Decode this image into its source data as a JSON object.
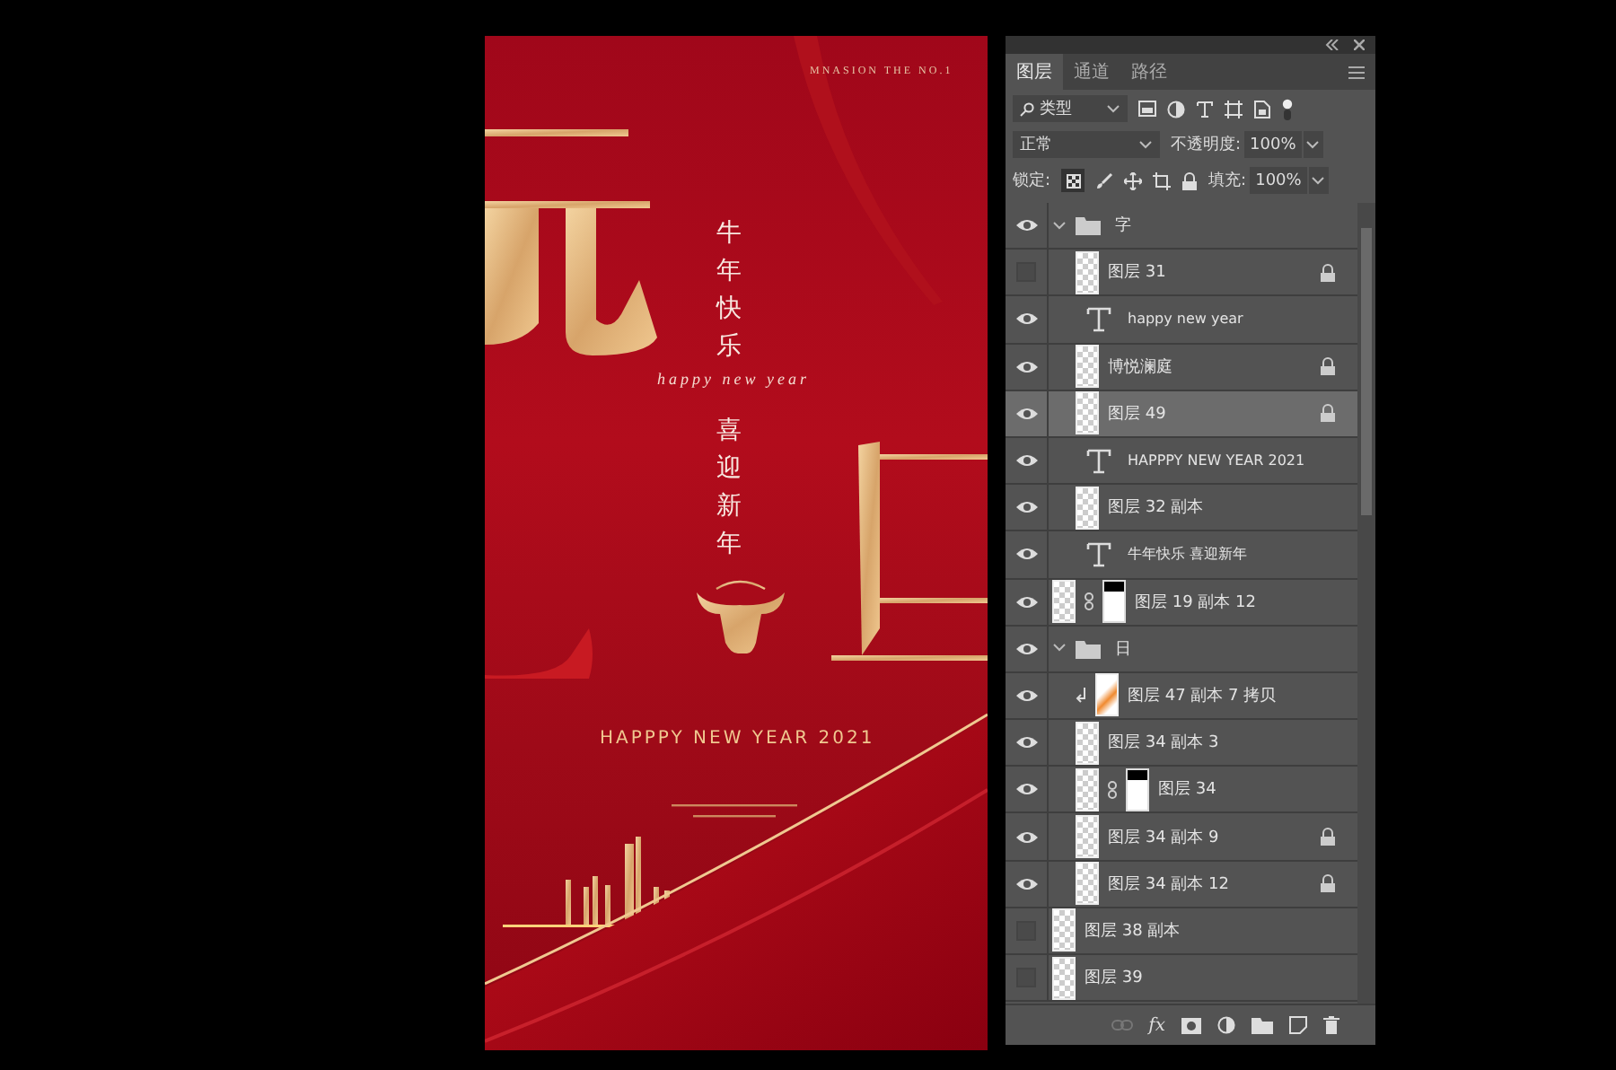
{
  "poster": {
    "tagline": "MNASION THE NO.1",
    "vertical_lines": [
      "牛年快乐",
      "喜迎新年"
    ],
    "script": "happy new year",
    "headline": "HAPPPY NEW YEAR 2021"
  },
  "panel": {
    "tabs": [
      {
        "label": "图层",
        "selected": true
      },
      {
        "label": "通道",
        "selected": false
      },
      {
        "label": "路径",
        "selected": false
      }
    ],
    "filter": {
      "value": "类型"
    },
    "blend_mode": "正常",
    "opacity": {
      "label": "不透明度:",
      "value": "100%"
    },
    "lock": {
      "label": "锁定:"
    },
    "fill": {
      "label": "填充:",
      "value": "100%"
    },
    "layers": [
      {
        "kind": "group",
        "name": "字",
        "visible": true,
        "expanded": true,
        "selected": false,
        "children": [
          {
            "kind": "pixel",
            "name": "图层 31",
            "visible": false,
            "locked": true,
            "selected": false
          },
          {
            "kind": "text",
            "name": "happy new year",
            "visible": true,
            "locked": false,
            "selected": false
          },
          {
            "kind": "pixel",
            "name": "博悦澜庭",
            "visible": true,
            "locked": true,
            "selected": false
          },
          {
            "kind": "pixel",
            "name": "图层 49",
            "visible": true,
            "locked": true,
            "selected": true
          },
          {
            "kind": "text",
            "name": "HAPPPY NEW YEAR 2021",
            "visible": true,
            "locked": false,
            "selected": false
          },
          {
            "kind": "pixel",
            "name": "图层 32 副本",
            "visible": true,
            "locked": false,
            "selected": false
          },
          {
            "kind": "text",
            "name": "牛年快乐   喜迎新年",
            "visible": true,
            "locked": false,
            "selected": false
          }
        ]
      },
      {
        "kind": "masked",
        "name": "图层 19 副本 12",
        "visible": true,
        "locked": false,
        "selected": false
      },
      {
        "kind": "group",
        "name": "日",
        "visible": true,
        "expanded": true,
        "selected": false,
        "children": [
          {
            "kind": "clipped",
            "name": "图层 47 副本 7 拷贝",
            "visible": true,
            "locked": false,
            "selected": false
          },
          {
            "kind": "pixel",
            "name": "图层 34 副本 3",
            "visible": true,
            "locked": false,
            "selected": false
          },
          {
            "kind": "masked",
            "name": "图层 34",
            "visible": true,
            "locked": false,
            "selected": false
          },
          {
            "kind": "pixel",
            "name": "图层 34 副本 9",
            "visible": true,
            "locked": true,
            "selected": false
          },
          {
            "kind": "pixel",
            "name": "图层 34 副本 12",
            "visible": true,
            "locked": true,
            "selected": false
          }
        ]
      },
      {
        "kind": "pixel",
        "name": "图层 38 副本",
        "visible": false,
        "locked": false,
        "selected": false
      },
      {
        "kind": "pixel",
        "name": "图层 39",
        "visible": false,
        "locked": false,
        "selected": false
      }
    ],
    "toolbar": {
      "fx": "fx"
    }
  }
}
